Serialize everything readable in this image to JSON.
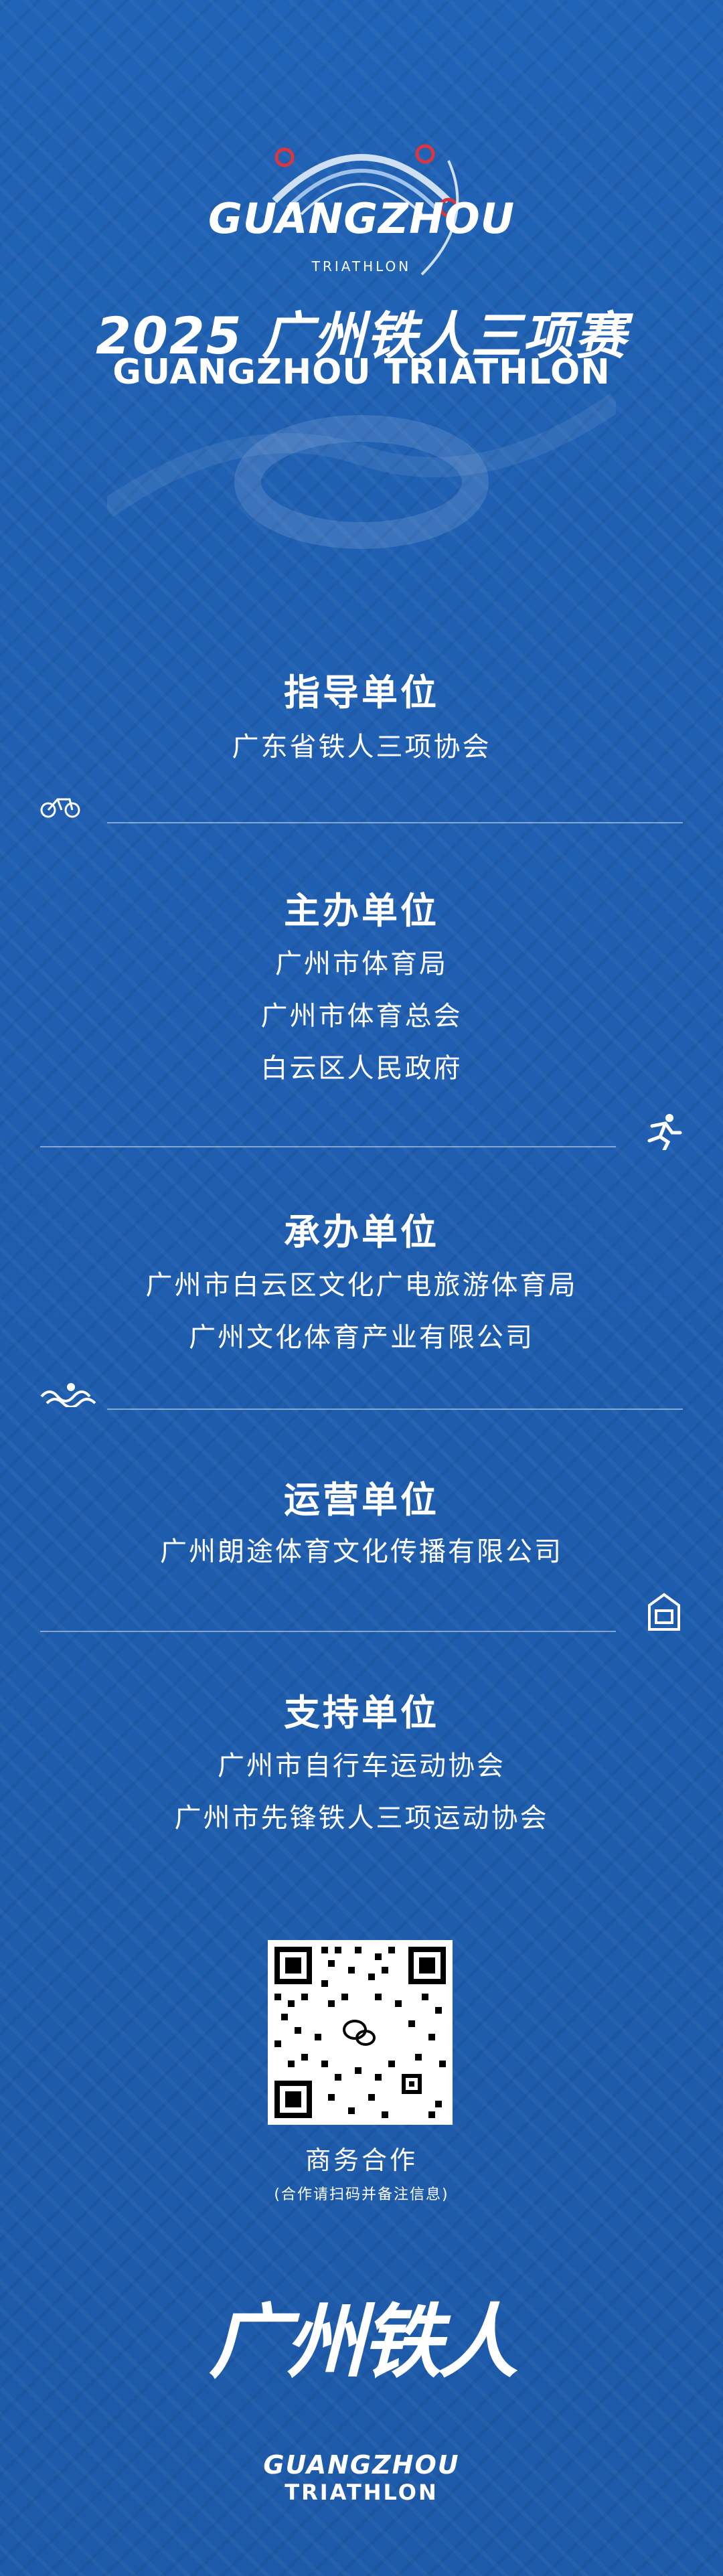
{
  "header": {
    "logo_line1": "GUANGZHOU",
    "logo_line2": "ZHOU",
    "logo_line3": "TRIATHLON",
    "event_title": "2025 广州铁人三项赛",
    "event_subtitle": "GUANGZHOU TRIATHLON"
  },
  "sections": [
    {
      "title": "指导单位",
      "lines": [
        "广东省铁人三项协会"
      ]
    },
    {
      "title": "主办单位",
      "lines": [
        "广州市体育局",
        "广州市体育总会",
        "白云区人民政府"
      ]
    },
    {
      "title": "承办单位",
      "lines": [
        "广州市白云区文化广电旅游体育局",
        "广州文化体育产业有限公司"
      ]
    },
    {
      "title": "运营单位",
      "lines": [
        "广州朗途体育文化传播有限公司"
      ]
    },
    {
      "title": "支持单位",
      "lines": [
        "广州市自行车运动协会",
        "广州市先锋铁人三项运动协会"
      ]
    }
  ],
  "qr": {
    "label": "商务合作",
    "note": "(合作请扫码并备注信息)"
  },
  "footer": {
    "logo_cn": "广州铁人",
    "logo_line1": "GUANGZHOU",
    "logo_line2": "TRIATHLON"
  },
  "colors": {
    "background": "#1f5fb0",
    "text": "#ffffff",
    "accent_red": "#d9363e"
  },
  "icons": [
    "bike-icon",
    "runner-icon",
    "swim-wave-icon",
    "tower-icon",
    "wechat-icon"
  ]
}
